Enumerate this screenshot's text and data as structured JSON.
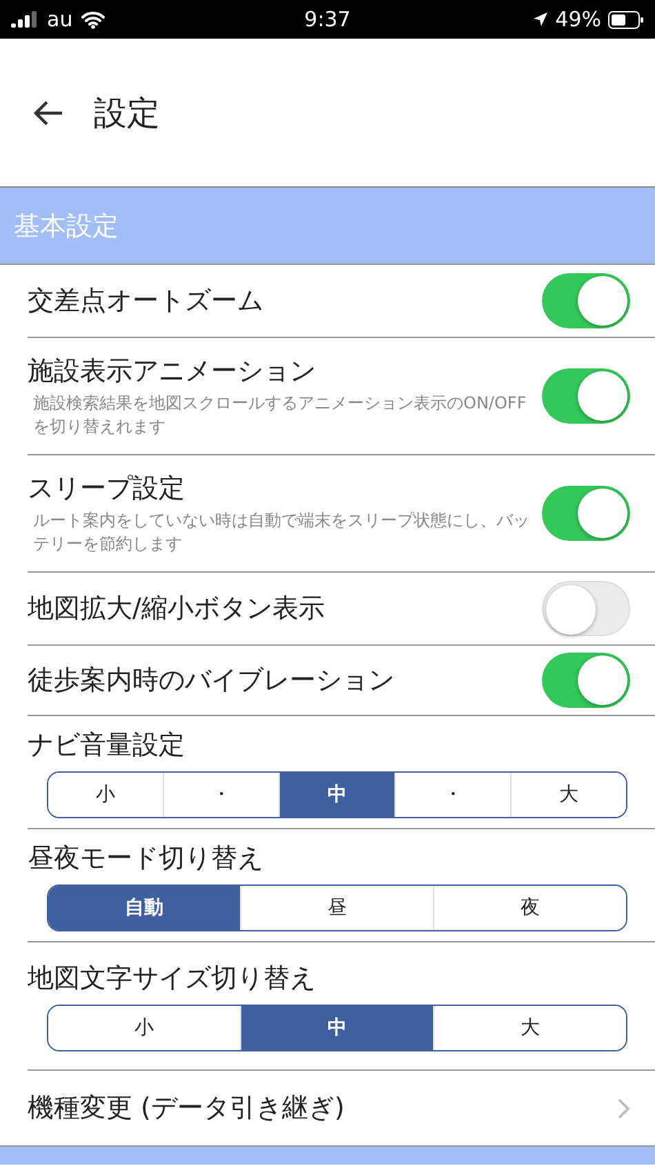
{
  "status_bar": {
    "carrier": "au",
    "time": "9:37",
    "battery": "49%"
  },
  "header": {
    "title": "設定"
  },
  "section": {
    "title": "基本設定"
  },
  "items": [
    {
      "kind": "toggle",
      "label": "交差点オートズーム",
      "on": true
    },
    {
      "kind": "toggle",
      "label": "施設表示アニメーション",
      "description": "施設検索結果を地図スクロールするアニメーション表示のON/OFFを切り替えれます",
      "on": true
    },
    {
      "kind": "toggle",
      "label": "スリープ設定",
      "description": "ルート案内をしていない時は自動で端末をスリープ状態にし、バッテリーを節約します",
      "on": true
    },
    {
      "kind": "toggle",
      "label": "地図拡大/縮小ボタン表示",
      "on": false
    },
    {
      "kind": "toggle",
      "label": "徒歩案内時のバイブレーション",
      "on": true
    },
    {
      "kind": "segmented",
      "label": "ナビ音量設定",
      "options": [
        {
          "label": "小",
          "selected": false
        },
        {
          "label": "・",
          "selected": false
        },
        {
          "label": "中",
          "selected": true
        },
        {
          "label": "・",
          "selected": false
        },
        {
          "label": "大",
          "selected": false
        }
      ]
    },
    {
      "kind": "segmented",
      "label": "昼夜モード切り替え",
      "options": [
        {
          "label": "自動",
          "selected": true
        },
        {
          "label": "昼",
          "selected": false
        },
        {
          "label": "夜",
          "selected": false
        }
      ]
    },
    {
      "kind": "segmented",
      "label": "地図文字サイズ切り替え",
      "options": [
        {
          "label": "小",
          "selected": false
        },
        {
          "label": "中",
          "selected": true
        },
        {
          "label": "大",
          "selected": false
        }
      ]
    },
    {
      "kind": "link",
      "label": "機種変更 (データ引き継ぎ)"
    }
  ]
}
